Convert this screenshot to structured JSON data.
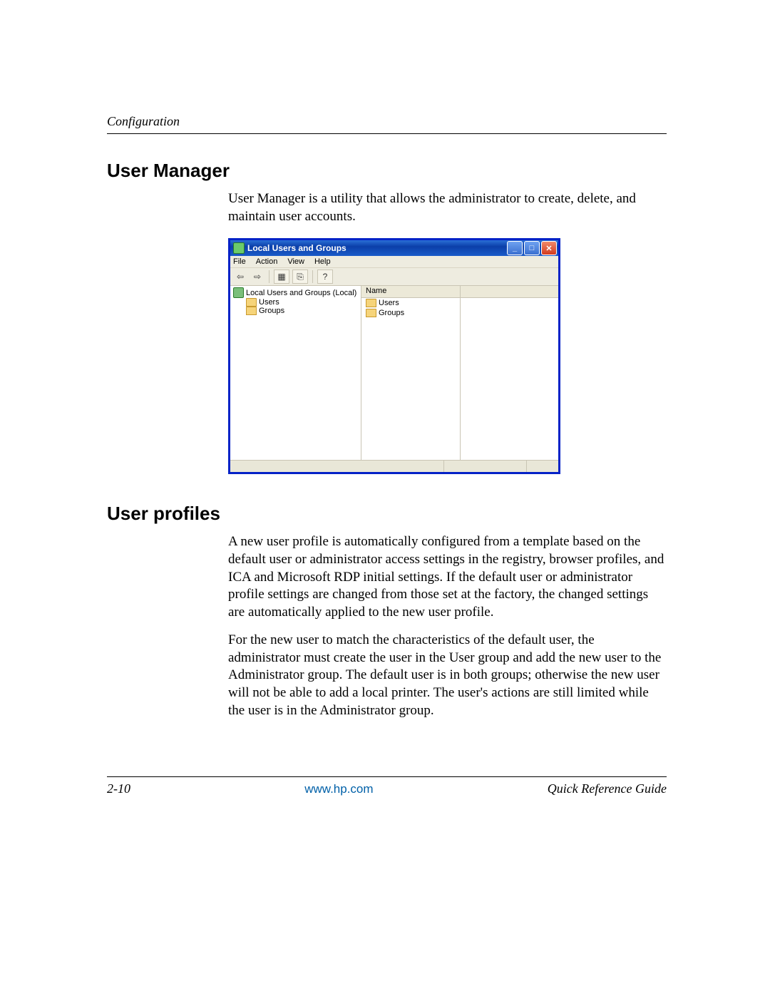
{
  "header": {
    "section": "Configuration"
  },
  "section1": {
    "title": "User Manager",
    "intro": "User Manager is a utility that allows the administrator to create, delete, and maintain user accounts."
  },
  "window": {
    "title": "Local Users and Groups",
    "menu": {
      "file": "File",
      "action": "Action",
      "view": "View",
      "help": "Help"
    },
    "tree": {
      "root": "Local Users and Groups (Local)",
      "items": [
        "Users",
        "Groups"
      ]
    },
    "list": {
      "header": "Name",
      "rows": [
        "Users",
        "Groups"
      ]
    }
  },
  "section2": {
    "title": "User profiles",
    "p1": "A new user profile is automatically configured from a template based on the default user or administrator access settings in the registry, browser profiles, and ICA and Microsoft RDP initial settings. If the default user or administrator profile settings are changed from those set at the factory, the changed settings are automatically applied to the new user profile.",
    "p2": "For the new user to match the characteristics of the default user, the administrator must create the user in the User group and add the new user to the Administrator group. The default user is in both groups; otherwise the new user will not be able to add a local printer. The user's actions are still limited while the user is in the Administrator group."
  },
  "footer": {
    "page": "2-10",
    "url": "www.hp.com",
    "guide": "Quick Reference Guide"
  }
}
